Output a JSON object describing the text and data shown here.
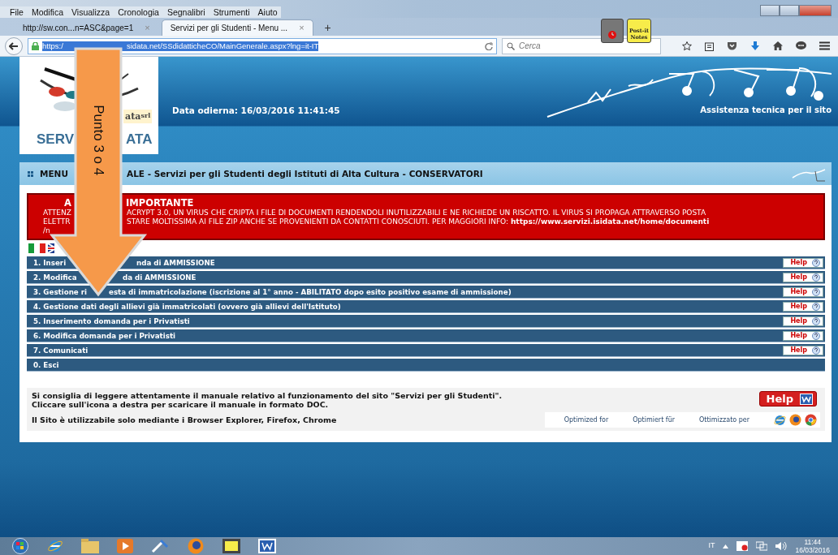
{
  "browser": {
    "menu": [
      "File",
      "Modifica",
      "Visualizza",
      "Cronologia",
      "Segnalibri",
      "Strumenti",
      "Aiuto"
    ],
    "tabs": [
      {
        "label": "http://sw.con...n=ASC&page=1",
        "close": "×",
        "selected": false
      },
      {
        "label": "Servizi per gli Studenti - Menu ...",
        "close": "×",
        "selected": true
      }
    ],
    "new_tab": "+",
    "url_parts": [
      "https:/",
      "sidata.net/SSdidatticheCO/MainGenerale.aspx?lng=it-IT"
    ],
    "search_placeholder": "Cerca"
  },
  "widgets": {
    "postit_title": "Post-it",
    "postit_sub": "Notes"
  },
  "header": {
    "logo_mark": "ata",
    "logo_sup": "srl",
    "logo_parts": [
      "SERV",
      "ATA"
    ],
    "date": "Data odierna: 16/03/2016 11:41:45",
    "support": "Assistenza tecnica per il sito"
  },
  "menu_title_parts": [
    "MENU",
    "ALE - Servizi per gli Studenti degli Istituti di Alta Cultura - CONSERVATORI"
  ],
  "alert": {
    "title_parts": [
      "A",
      "IMPORTANTE"
    ],
    "lines": [
      [
        "ATTENZ",
        "ACRYPT 3.0, UN VIRUS CHE CRIPTA I FILE DI DOCUMENTI RENDENDOLI INUTILIZZABILI E NE RICHIEDE UN RISCATTO. IL VIRUS SI PROPAGA ATTRAVERSO POSTA"
      ],
      [
        "ELETTR",
        "STARE MOLTISSIMA AI FILE ZIP ANCHE SE PROVENIENTI DA CONTATTI CONOSCIUTI. PER MAGGIORI INFO: **https://www.servizi.isidata.net/home/documenti**"
      ],
      [
        "/n"
      ]
    ]
  },
  "menu_items": [
    {
      "parts": [
        "1. Inseri",
        "nda di AMMISSIONE"
      ],
      "help": "Help"
    },
    {
      "parts": [
        "2. Modifica",
        "da di AMMISSIONE"
      ],
      "help": "Help"
    },
    {
      "parts": [
        "3. Gestione ri",
        "esta di immatricolazione (iscrizione al 1° anno - ABILITATO dopo esito positivo esame di ammissione)"
      ],
      "help": "Help"
    },
    {
      "parts": [
        "4. Gestione dati degli allievi già immatricolati (ovvero già allievi dell'Istituto)"
      ],
      "help": "Help"
    },
    {
      "parts": [
        "5. Inserimento domanda per i Privatisti"
      ],
      "help": "Help"
    },
    {
      "parts": [
        "6. Modifica domanda per i Privatisti"
      ],
      "help": "Help"
    },
    {
      "parts": [
        "7. Comunicati"
      ],
      "help": "Help"
    },
    {
      "parts": [
        "0. Esci"
      ]
    }
  ],
  "info": {
    "lines": [
      "Si consiglia di leggere attentamente il manuale relativo al funzionamento del sito \"Servizi per gli Studenti\".",
      "Cliccare sull'icona a destra per scaricare il manuale in formato DOC."
    ],
    "help_label": "Help",
    "browsers_note": "Il Sito è utilizzabile solo mediante i Browser Explorer, Firefox, Chrome",
    "optimized": [
      "Optimized for",
      "Optimiert für",
      "Ottimizzato per"
    ]
  },
  "annotation": {
    "label": "Punto 3 o 4"
  },
  "taskbar": {
    "language": "IT",
    "time": "11:44",
    "date": "16/03/2016"
  }
}
